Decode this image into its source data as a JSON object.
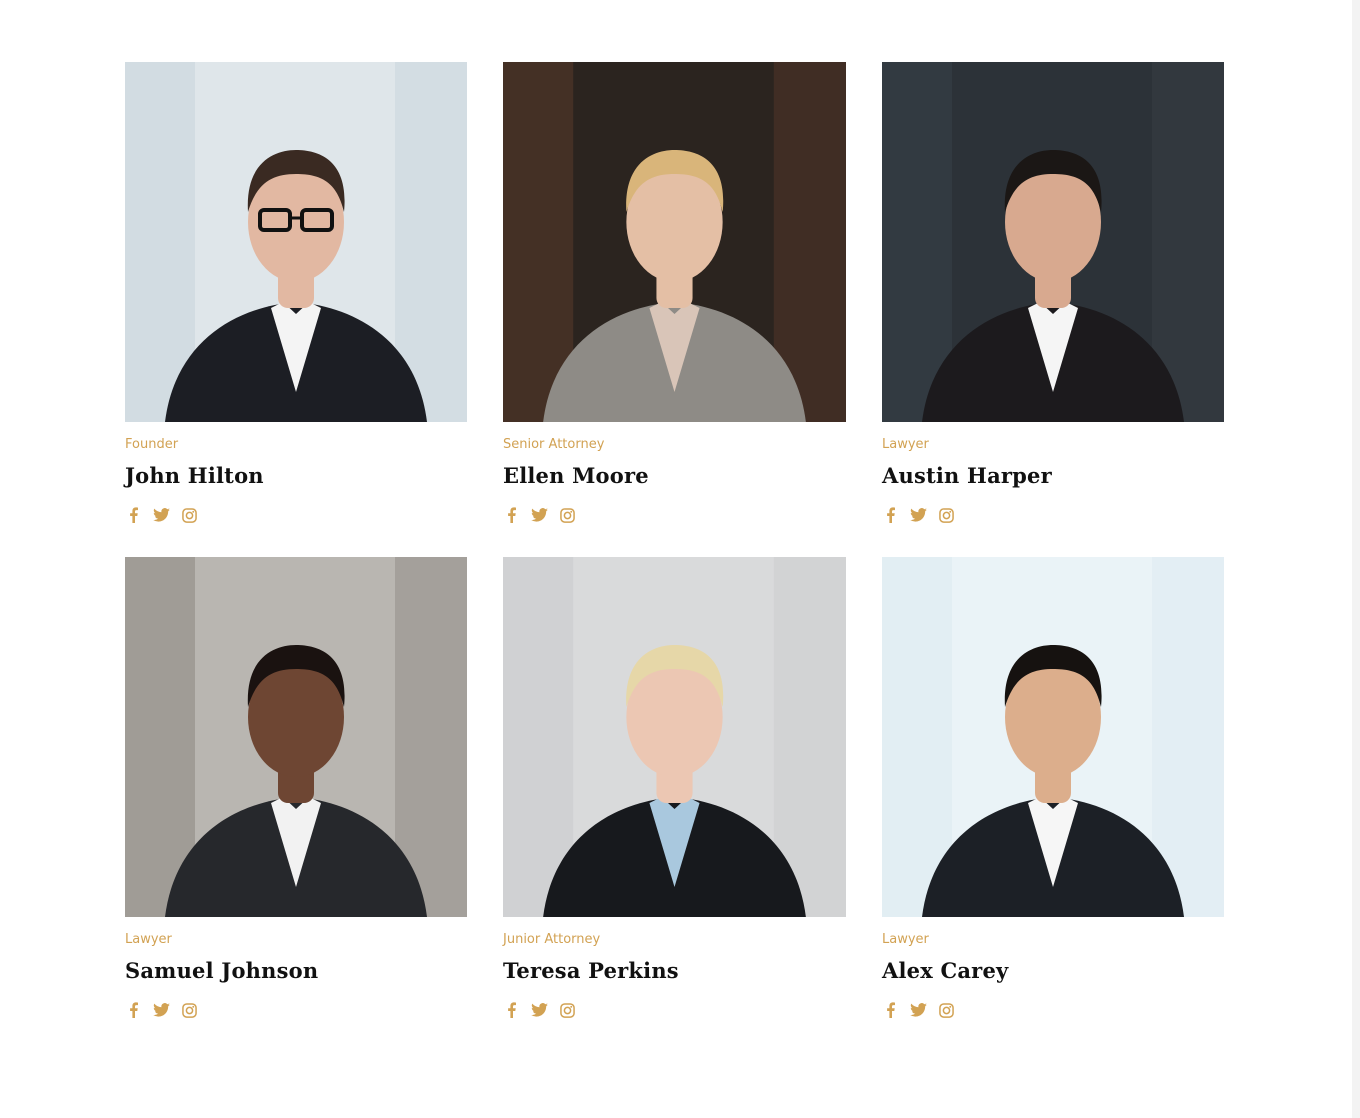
{
  "accent_color": "#d2a253",
  "team": [
    {
      "role": "Founder",
      "name": "John Hilton",
      "photo": {
        "background": "#dfe6ea",
        "accent": "#c6d3db",
        "skin": "#e2b8a2",
        "hair": "#3a2a22",
        "suit": "#1c1e24",
        "shirt": "#f4f4f4",
        "glasses": true
      }
    },
    {
      "role": "Senior Attorney",
      "name": "Ellen Moore",
      "photo": {
        "background": "#2b241f",
        "accent": "#5a3a2a",
        "skin": "#e4bfa5",
        "hair": "#d9b57a",
        "suit": "#8e8b86",
        "shirt": "#d9c5b8",
        "glasses": false
      }
    },
    {
      "role": "Lawyer",
      "name": "Austin Harper",
      "photo": {
        "background": "#2c3238",
        "accent": "#394148",
        "skin": "#d8a98f",
        "hair": "#1b1715",
        "suit": "#1c1a1d",
        "shirt": "#f5f5f5",
        "glasses": false
      }
    },
    {
      "role": "Lawyer",
      "name": "Samuel Johnson",
      "photo": {
        "background": "#b9b6b1",
        "accent": "#8c8680",
        "skin": "#6e4633",
        "hair": "#1a1210",
        "suit": "#26282c",
        "shirt": "#f2f2f2",
        "glasses": false
      }
    },
    {
      "role": "Junior Attorney",
      "name": "Teresa Perkins",
      "photo": {
        "background": "#d9dadb",
        "accent": "#c9cacc",
        "skin": "#ecc7b3",
        "hair": "#e6d7a8",
        "suit": "#17191d",
        "shirt": "#a9c8de",
        "glasses": false
      }
    },
    {
      "role": "Lawyer",
      "name": "Alex Carey",
      "photo": {
        "background": "#eaf3f7",
        "accent": "#dbe9f0",
        "skin": "#dcae8c",
        "hair": "#161210",
        "suit": "#1c2026",
        "shirt": "#f6f6f6",
        "glasses": false
      }
    }
  ],
  "social_icons": [
    "facebook-icon",
    "twitter-icon",
    "instagram-icon"
  ]
}
